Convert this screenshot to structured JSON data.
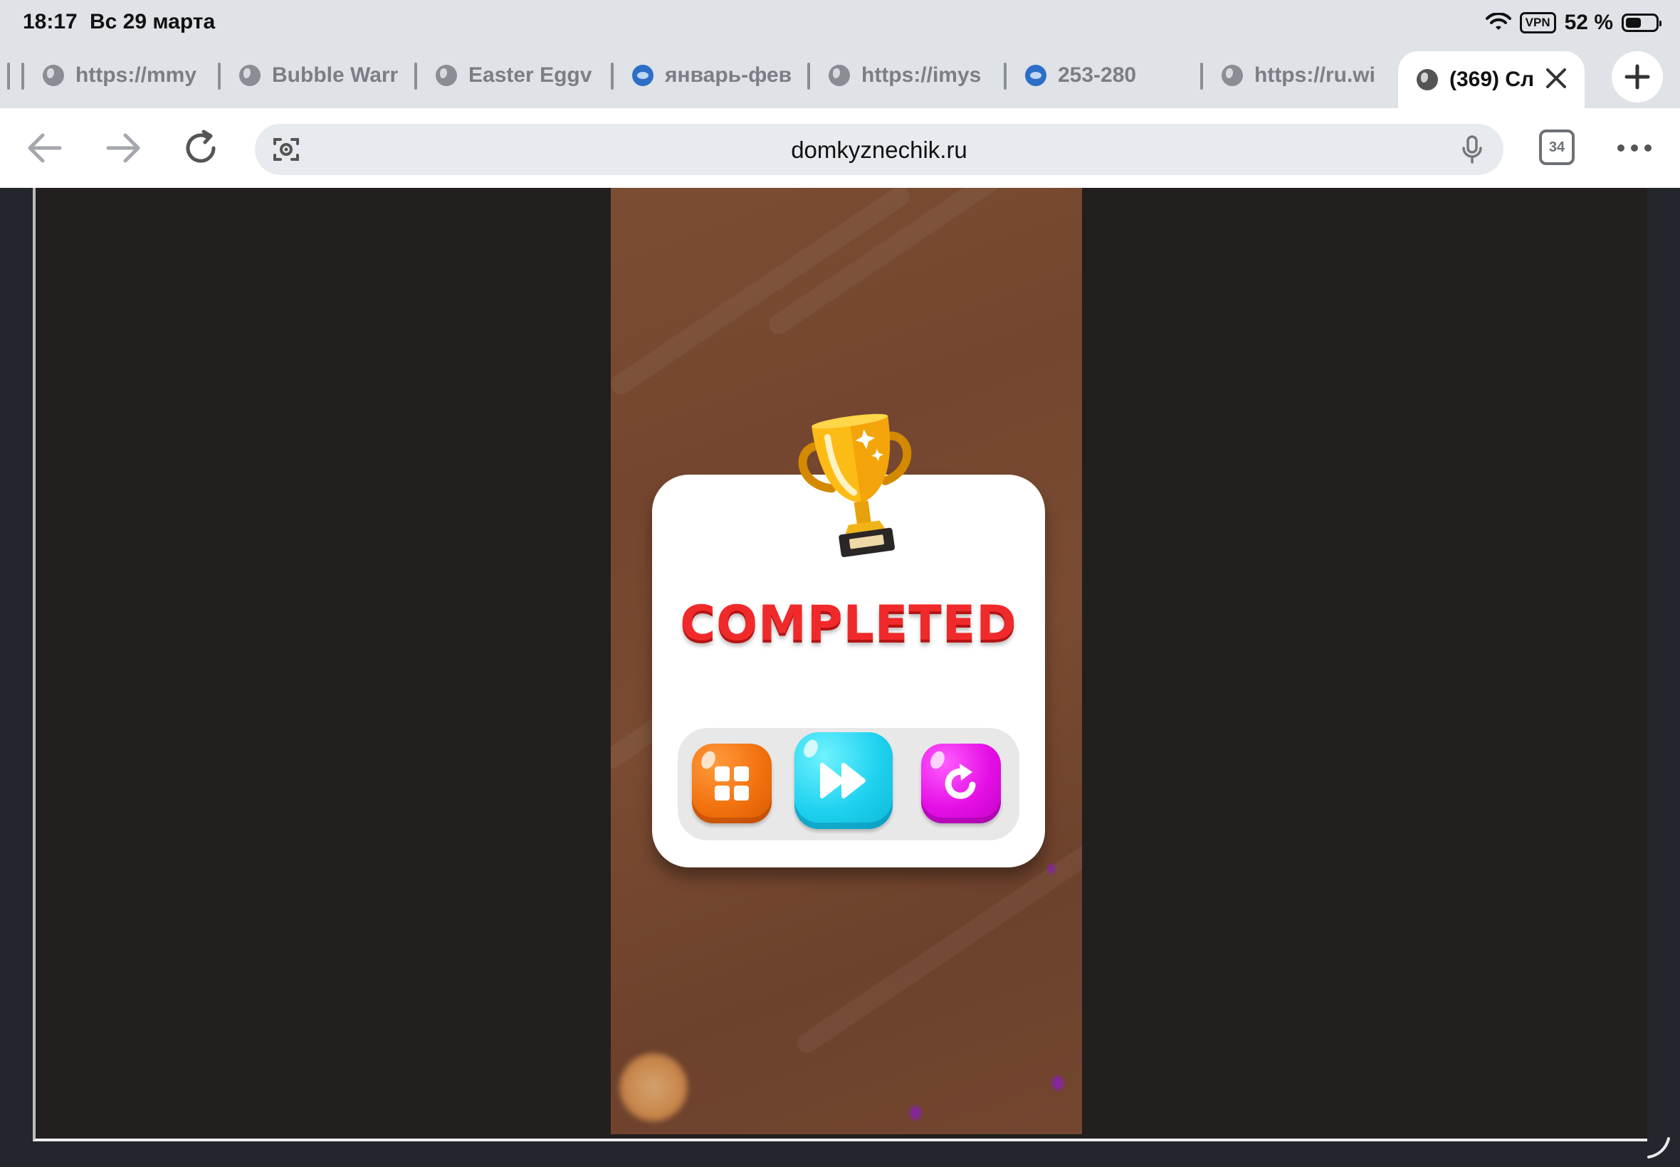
{
  "status_bar": {
    "time": "18:17",
    "date": "Вс 29 марта",
    "vpn_label": "VPN",
    "battery_percent": "52 %",
    "battery_level": 0.52
  },
  "tabs": [
    {
      "label": "https://mmy",
      "icon": "globe-icon"
    },
    {
      "label": "Bubble Warr",
      "icon": "globe-icon"
    },
    {
      "label": "Easter Eggv",
      "icon": "globe-icon"
    },
    {
      "label": "январь-фев",
      "icon": "site-logo-icon"
    },
    {
      "label": "https://imys",
      "icon": "globe-icon"
    },
    {
      "label": "253-280",
      "icon": "site-logo-icon"
    },
    {
      "label": "https://ru.wi",
      "icon": "globe-icon"
    },
    {
      "label": "(369) Сл",
      "icon": "globe-icon",
      "active": true
    }
  ],
  "toolbar": {
    "url": "domkyznechik.ru",
    "tab_count": "34"
  },
  "game": {
    "title": "COMPLETED",
    "buttons": [
      {
        "name": "levels-menu",
        "icon": "grid-icon",
        "color": "#f2720e"
      },
      {
        "name": "next-level",
        "icon": "fast-forward-icon",
        "color": "#1fd2ef"
      },
      {
        "name": "restart",
        "icon": "restart-icon",
        "color": "#e50fe6"
      }
    ],
    "accent_color": "#f02a2a"
  }
}
